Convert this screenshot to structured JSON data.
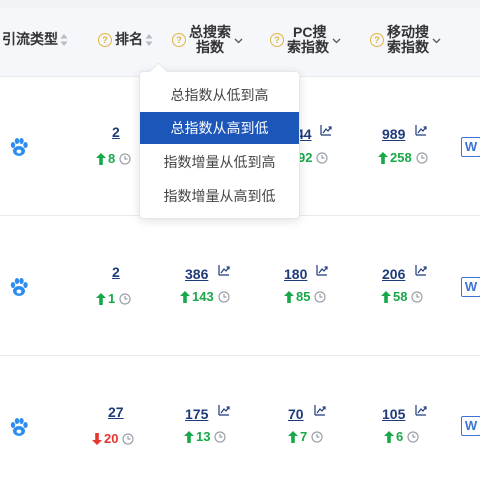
{
  "header": {
    "col_type": "引流类型",
    "col_rank": "排名",
    "col_total_line1": "总搜索",
    "col_total_line2": "指数",
    "col_pc_line1": "PC搜",
    "col_pc_line2": "索指数",
    "col_mobile_line1": "移动搜",
    "col_mobile_line2": "索指数",
    "help_glyph": "?"
  },
  "dropdown": {
    "options": [
      "总指数从低到高",
      "总指数从高到低",
      "指数增量从低到高",
      "指数增量从高到低"
    ],
    "selected_index": 1
  },
  "rows": [
    {
      "source_icon": "baidu-paw-icon",
      "rank": "2",
      "rank_delta": "8",
      "rank_dir": "up",
      "total": "",
      "total_delta": "",
      "pc": "44",
      "pc_delta": "92",
      "pc_dir": "up",
      "mobile": "989",
      "mobile_delta": "258",
      "mobile_dir": "up",
      "w_label": "W"
    },
    {
      "source_icon": "baidu-paw-icon",
      "rank": "2",
      "rank_delta": "1",
      "rank_dir": "up",
      "total": "386",
      "total_delta": "143",
      "total_dir": "up",
      "pc": "180",
      "pc_delta": "85",
      "pc_dir": "up",
      "mobile": "206",
      "mobile_delta": "58",
      "mobile_dir": "up",
      "w_label": "W"
    },
    {
      "source_icon": "baidu-paw-icon",
      "rank": "27",
      "rank_delta": "20",
      "rank_dir": "down",
      "total": "175",
      "total_delta": "13",
      "total_dir": "up",
      "pc": "70",
      "pc_delta": "7",
      "pc_dir": "up",
      "mobile": "105",
      "mobile_delta": "6",
      "mobile_dir": "up",
      "w_label": "W"
    }
  ],
  "colors": {
    "up": "#18a84a",
    "down": "#e8352e",
    "link": "#1f3b7a",
    "accent": "#1c56b8",
    "help": "#e3b443"
  }
}
